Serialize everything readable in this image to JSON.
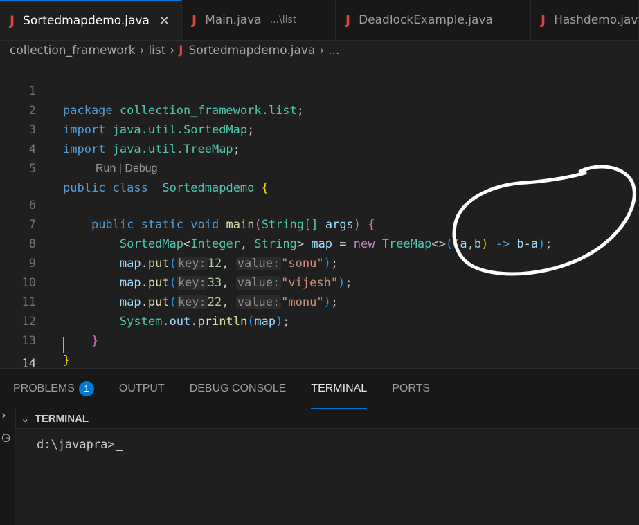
{
  "tabs": [
    {
      "label": "Sortedmapdemo.java",
      "close": "✕"
    },
    {
      "label": "Main.java",
      "hint": "...\\list"
    },
    {
      "label": "DeadlockExample.java"
    },
    {
      "label": "Hashdemo.java"
    }
  ],
  "breadcrumb": {
    "parts": [
      "collection_framework",
      "list"
    ],
    "file": "Sortedmapdemo.java",
    "more": "..."
  },
  "editor": {
    "line_numbers": [
      "1",
      "2",
      "3",
      "4",
      "5",
      "6",
      "7",
      "8",
      "9",
      "10",
      "11",
      "12",
      "13",
      "14"
    ],
    "codelens": "Run | Debug",
    "tokens": {
      "package": "package",
      "pkg_name": "collection_framework.list",
      "import": "import",
      "imp1": "java.util.SortedMap",
      "imp2": "java.util.TreeMap",
      "public": "public",
      "class": "class",
      "cls_name": "Sortedmapdemo",
      "static": "static",
      "void": "void",
      "main": "main",
      "string_arr": "String[]",
      "args": "args",
      "sortedmap": "SortedMap",
      "integer": "Integer",
      "string": "String",
      "map": "map",
      "new": "new",
      "treemap": "TreeMap",
      "lambda_a": "a",
      "lambda_b": "b",
      "arrow": "->",
      "b_minus_a_b": "b",
      "b_minus_a_a": "a",
      "put": "put",
      "key_hint": "key:",
      "value_hint": "value:",
      "k1": "12",
      "v1": "\"sonu\"",
      "k2": "33",
      "v2": "\"vijesh\"",
      "k3": "22",
      "v3": "\"monu\"",
      "system": "System",
      "out": "out",
      "println": "println"
    }
  },
  "panel": {
    "tabs": [
      "PROBLEMS",
      "OUTPUT",
      "DEBUG CONSOLE",
      "TERMINAL",
      "PORTS"
    ],
    "problems_count": "1",
    "terminal_header": "TERMINAL",
    "prompt": "d:\\javapra>"
  }
}
